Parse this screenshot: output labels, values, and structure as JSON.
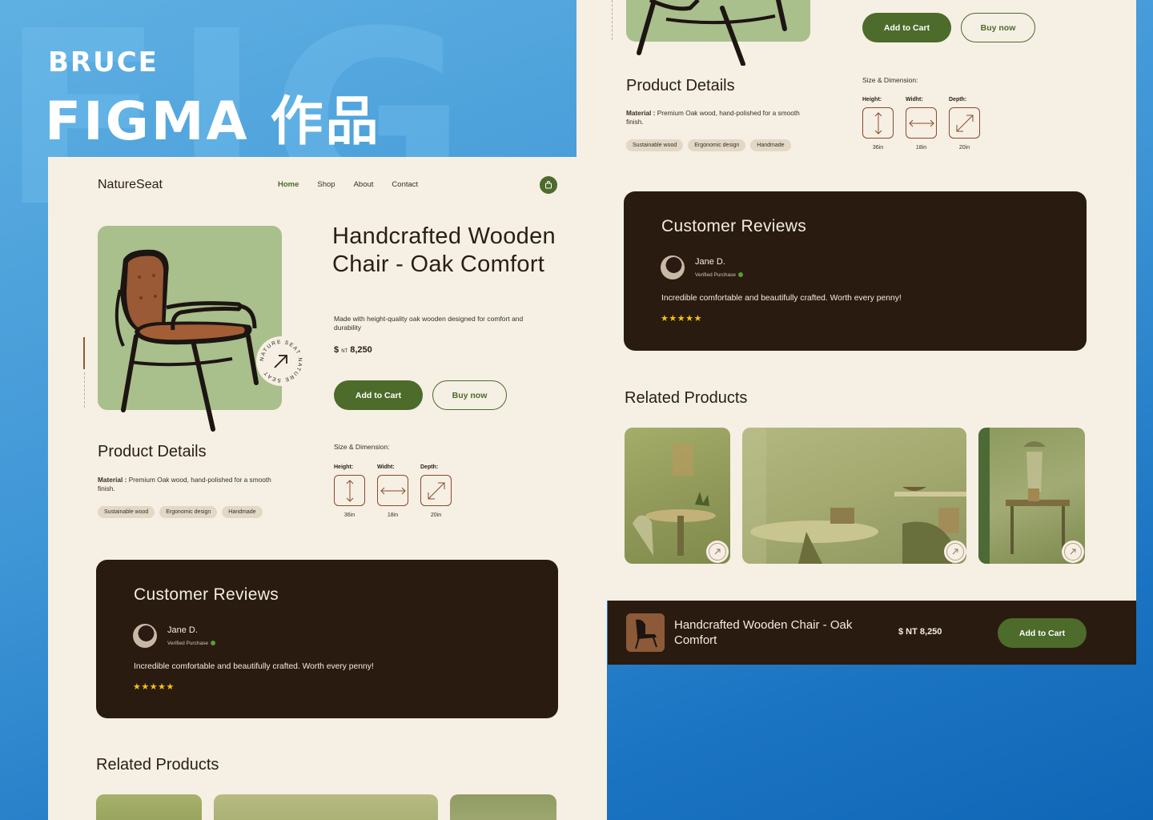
{
  "brand": {
    "top": "BRUCE",
    "main": "FIGMA 作品",
    "bg_text": "FIG"
  },
  "nav": {
    "logo": "NatureSeat",
    "links": [
      "Home",
      "Shop",
      "About",
      "Contact"
    ]
  },
  "product": {
    "title": "Handcrafted Wooden Chair - Oak Comfort",
    "description": "Made with height-quality oak wooden designed for comfort and durability",
    "price_currency": "$",
    "price_unit": "NT",
    "price_value": "8,250",
    "badge_text": "NATURE SEAT NATURE SEAT",
    "add_to_cart": "Add to Cart",
    "buy_now": "Buy now"
  },
  "details": {
    "title": "Product Details",
    "material_label": "Material :",
    "material_text": " Premium Oak wood, hand-polished for a smooth finish.",
    "tags": [
      "Sustainable wood",
      "Ergonomic design",
      "Handmade"
    ],
    "dimension_title": "Size & Dimension:",
    "dimensions": [
      {
        "label": "Height:",
        "value": "36in",
        "icon": "vertical-arrow-icon"
      },
      {
        "label": "Widht:",
        "value": "18in",
        "icon": "horizontal-arrow-icon"
      },
      {
        "label": "Depth:",
        "value": "20in",
        "icon": "diagonal-arrow-icon"
      }
    ]
  },
  "reviews": {
    "title": "Customer Reviews",
    "name": "Jane D.",
    "verified": "Verified Purchase",
    "text": "Incredible comfortable and beautifully crafted. Worth every penny!",
    "stars": "★★★★★",
    "rating": 5
  },
  "related": {
    "title": "Related Products"
  },
  "sticky": {
    "name": "Handcrafted Wooden Chair - Oak Comfort",
    "price": "$ NT 8,250",
    "add_to_cart": "Add to Cart"
  },
  "colors": {
    "accent_green": "#4d6b2a",
    "cream": "#f6efe4",
    "dark_brown": "#2a1b10",
    "sage": "#a9bf8c",
    "star_yellow": "#f2c21b"
  }
}
